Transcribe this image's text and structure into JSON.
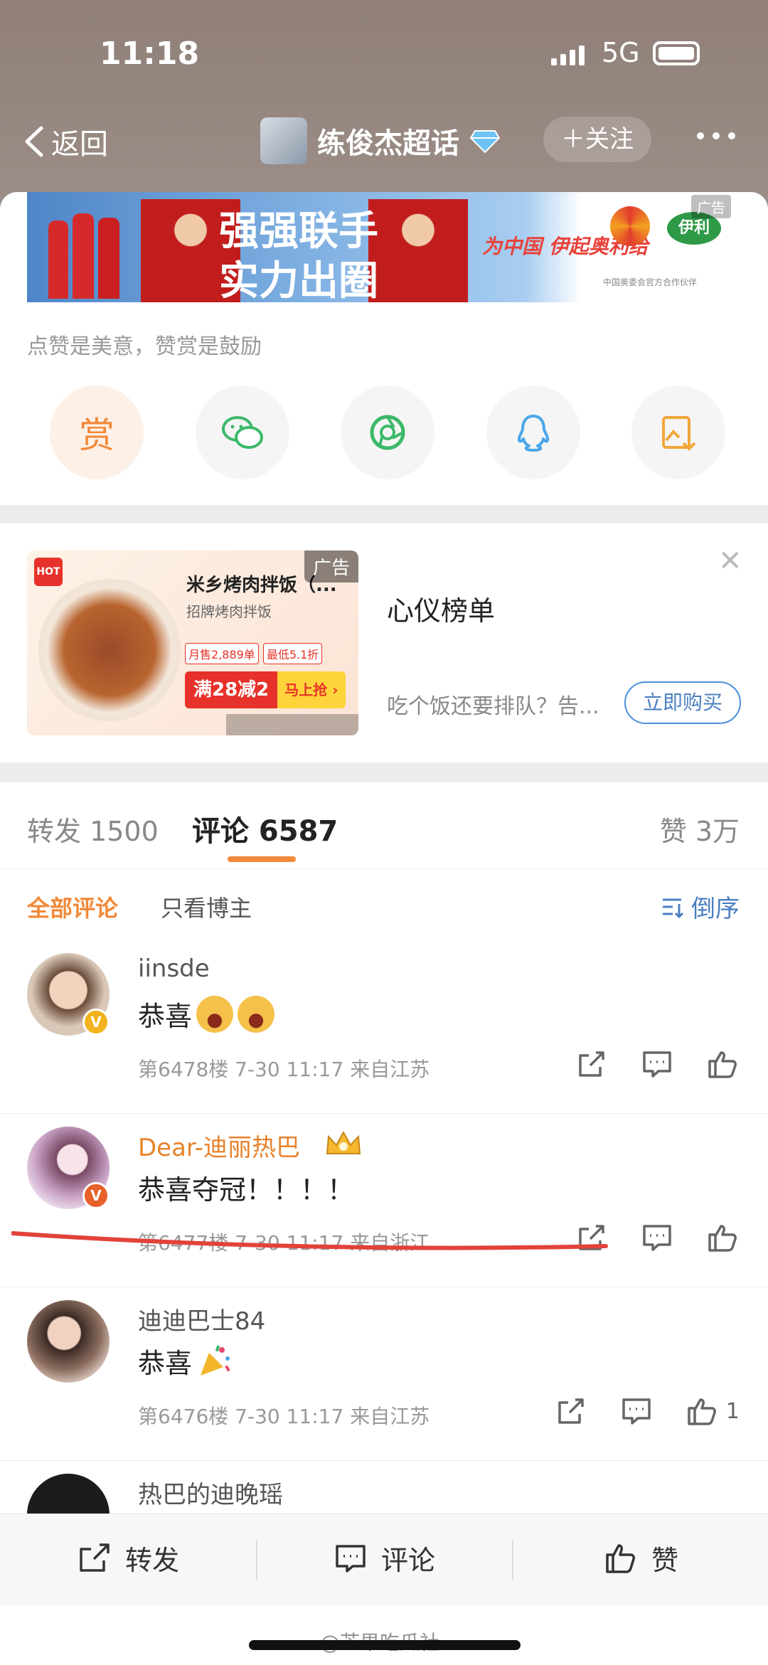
{
  "status_bar": {
    "time": "11:18",
    "network": "5G"
  },
  "nav": {
    "back_label": "返回",
    "title": "练俊杰超话",
    "follow_label": "＋关注"
  },
  "banner_ad": {
    "headline_1": "强强联手",
    "headline_2": "实力出圈",
    "slogan": "为中国 伊起奥利给",
    "brand": "伊利",
    "ad_tag": "广告",
    "footer": "中国奥委会官方合作伙伴"
  },
  "reward": {
    "hint": "点赞是美意，赞赏是鼓励",
    "buttons": [
      {
        "label": "赏",
        "icon": "reward-icon"
      },
      {
        "icon": "wechat-icon"
      },
      {
        "icon": "moments-icon"
      },
      {
        "icon": "qq-icon"
      },
      {
        "icon": "save-image-icon"
      }
    ]
  },
  "feed_ad": {
    "ad_tag": "广告",
    "shop_name": "米乡烤肉拌饭（...",
    "shop_sub": "招牌烤肉拌饭",
    "tag_1": "月售2,889单",
    "tag_2": "最低5.1折",
    "deal": "满28减2",
    "grab": "马上抢 ›",
    "hot": "HOT",
    "title": "心仪榜单",
    "desc": "吃个饭还要排队？告...",
    "buy_label": "立即购买"
  },
  "tabs": {
    "forward": "转发 1500",
    "comments": "评论 6587",
    "likes": "赞 3万"
  },
  "filters": {
    "all": "全部评论",
    "owner_only": "只看博主",
    "sort": "倒序"
  },
  "comments": [
    {
      "user": "iinsde",
      "text": "恭喜",
      "meta": "第6478楼  7-30 11:17  来自江苏",
      "likes": ""
    },
    {
      "user": "Dear-迪丽热巴",
      "text": "恭喜夺冠！！！！",
      "meta": "第6477楼  7-30 11:17  来自浙江",
      "likes": ""
    },
    {
      "user": "迪迪巴士84",
      "text": "恭喜",
      "meta": "第6476楼  7-30 11:17  来自江苏",
      "likes": "1"
    },
    {
      "user": "热巴的迪晚瑶",
      "text": "",
      "meta": "",
      "likes": ""
    }
  ],
  "bottom_bar": {
    "forward": "转发",
    "comment": "评论",
    "like": "赞"
  },
  "watermark": "@芒果吃瓜社",
  "colors": {
    "accent": "#f2893a",
    "link": "#4a7fc0",
    "header_bg": "#8f7f78",
    "ad_red": "#e6322a"
  }
}
